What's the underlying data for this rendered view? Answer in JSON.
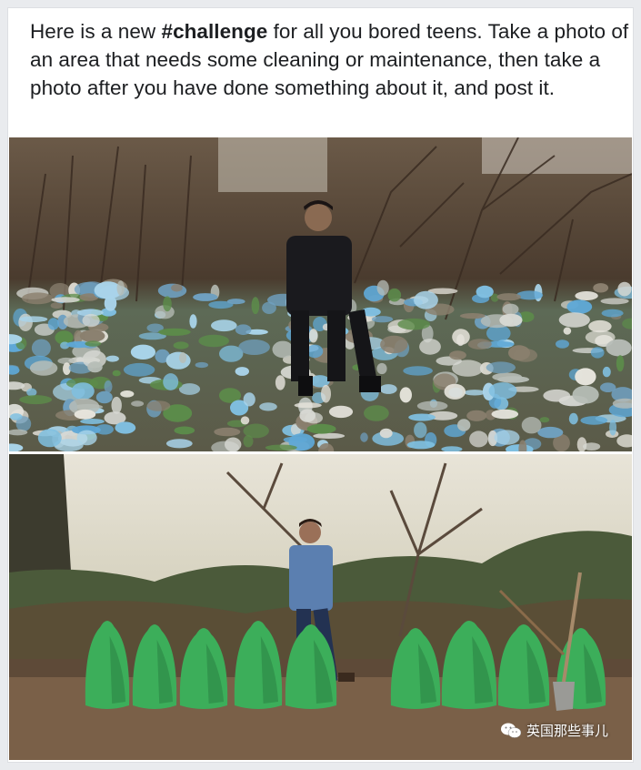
{
  "post": {
    "text_prefix": "Here is a new ",
    "hashtag": "#challenge",
    "text_suffix": " for all you bored teens. Take a photo of an area that needs some cleaning or maintenance, then take a photo after you have done something about it, and post it."
  },
  "watermark": {
    "icon": "wechat-icon",
    "text": "英国那些事儿"
  },
  "colors": {
    "page_bg": "#e9ebee",
    "card_bg": "#ffffff",
    "text": "#1c1e21",
    "trash_blue": "#5fa8d6",
    "bag_green": "#3cae5a"
  }
}
